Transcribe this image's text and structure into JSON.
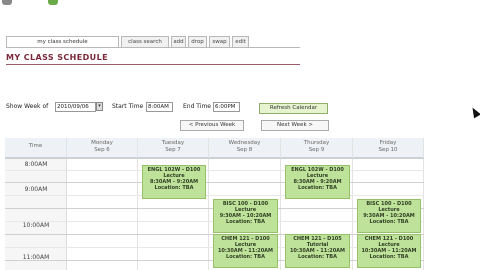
{
  "tabs": [
    {
      "label": "my class schedule",
      "active": true
    },
    {
      "label": "class search",
      "active": false
    },
    {
      "label": "add",
      "active": false
    },
    {
      "label": "drop",
      "active": false
    },
    {
      "label": "swap",
      "active": false
    },
    {
      "label": "edit",
      "active": false
    }
  ],
  "page_title": "MY CLASS SCHEDULE",
  "controls": {
    "show_week_label": "Show Week of",
    "show_week_value": "2010/09/06",
    "start_time_label": "Start Time",
    "start_time_value": "8:00AM",
    "end_time_label": "End Time",
    "end_time_value": "6:00PM",
    "refresh_label": "Refresh Calendar",
    "prev_week_label": "< Previous Week",
    "next_week_label": "Next Week >"
  },
  "calendar": {
    "time_header": "Time",
    "days": [
      {
        "name": "Monday",
        "date": "Sep 6"
      },
      {
        "name": "Tuesday",
        "date": "Sep 7"
      },
      {
        "name": "Wednesday",
        "date": "Sep 8"
      },
      {
        "name": "Thursday",
        "date": "Sep 9"
      },
      {
        "name": "Friday",
        "date": "Sep 10"
      }
    ],
    "times": [
      "8:00AM",
      "9:00AM",
      "10:00AM",
      "11:00AM"
    ],
    "events": {
      "tue_engl": [
        "ENGL 102W - D100",
        "Lecture",
        "8:30AM - 9:20AM",
        "Location: TBA"
      ],
      "thu_engl": [
        "ENGL 102W - D100",
        "Lecture",
        "8:30AM - 9:20AM",
        "Location: TBA"
      ],
      "wed_biss": [
        "BISC 100 - D100",
        "Lecture",
        "9:30AM - 10:20AM",
        "Location: TBA"
      ],
      "fri_biss": [
        "BISC 100 - D100",
        "Lecture",
        "9:30AM - 10:20AM",
        "Location: TBA"
      ],
      "wed_chem": [
        "CHEM 121 - D100",
        "Lecture",
        "10:30AM - 11:20AM",
        "Location: TBA"
      ],
      "thu_chem": [
        "CHEM 121 - D105",
        "Tutorial",
        "10:30AM - 11:20AM",
        "Location: TBA"
      ],
      "fri_chem": [
        "CHEM 121 - D100",
        "Lecture",
        "10:30AM - 11:20AM",
        "Location: TBA"
      ]
    }
  },
  "colors": {
    "title": "#7a2a3a",
    "event_bg": "#bfe29a",
    "refresh_bg": "#e6f3cf"
  }
}
